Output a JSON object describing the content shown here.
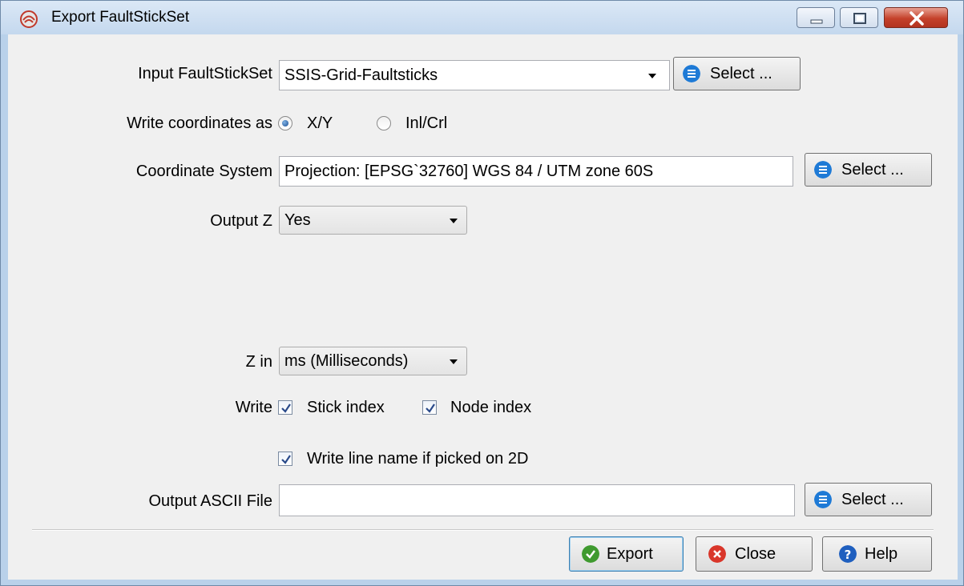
{
  "window": {
    "title": "Export FaultStickSet"
  },
  "input_faultstickset": {
    "label": "Input FaultStickSet",
    "value": "SSIS-Grid-Faultsticks",
    "select_label": "Select ..."
  },
  "write_coordinates": {
    "label": "Write coordinates as",
    "options": [
      "X/Y",
      "Inl/Crl"
    ],
    "selected": "X/Y"
  },
  "coordinate_system": {
    "label": "Coordinate System",
    "value": "Projection: [EPSG`32760] WGS 84 / UTM zone 60S",
    "select_label": "Select ..."
  },
  "output_z": {
    "label": "Output Z",
    "value": "Yes"
  },
  "z_in": {
    "label": "Z in",
    "value": "ms (Milliseconds)"
  },
  "write": {
    "label": "Write",
    "stick_index_label": "Stick index",
    "stick_index_checked": true,
    "node_index_label": "Node index",
    "node_index_checked": true,
    "line_name_label": "Write line name if picked on 2D",
    "line_name_checked": true
  },
  "output_ascii": {
    "label": "Output ASCII File",
    "value": "",
    "select_label": "Select ..."
  },
  "footer": {
    "export_label": "Export",
    "close_label": "Close",
    "help_label": "Help"
  },
  "colors": {
    "select_icon": "#1e7ad6",
    "export_icon": "#3f9a2f",
    "close_icon": "#d9362a",
    "help_icon": "#1f5fbf"
  }
}
